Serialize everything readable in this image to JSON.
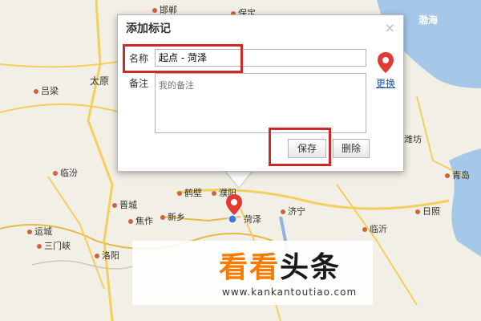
{
  "dialog": {
    "title": "添加标记",
    "close_label": "×",
    "name_label": "名称",
    "name_value": "起点 - 菏泽",
    "note_label": "备注",
    "note_placeholder": "我的备注",
    "change_link": "更换",
    "save_label": "保存",
    "delete_label": "删除"
  },
  "map": {
    "cities": [
      "吕梁",
      "太原",
      "临汾",
      "晋城",
      "焦作",
      "新乡",
      "鹤壁",
      "濮阳",
      "菏泽",
      "济宁",
      "运城",
      "三门峡",
      "洛阳",
      "日照",
      "临沂",
      "青岛",
      "潍坊",
      "邯郸",
      "保定"
    ],
    "sea_label": "渤海"
  },
  "watermark": {
    "brand_a": "看看",
    "brand_b": "头条",
    "url": "www.kankantoutiao.com"
  },
  "colors": {
    "marker_red": "#e53935",
    "highlight_red": "#c92a2a",
    "link_blue": "#2255aa",
    "brand_orange": "#f57c00"
  }
}
